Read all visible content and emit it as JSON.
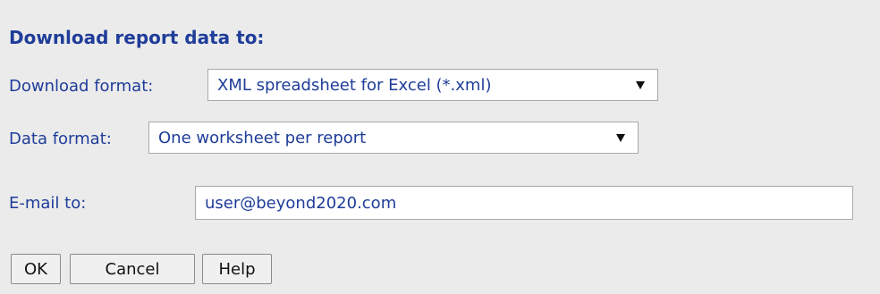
{
  "dialog": {
    "title": "Download report data to:"
  },
  "download_format": {
    "label": "Download format:",
    "selected": "XML spreadsheet for Excel (*.xml)"
  },
  "data_format": {
    "label": "Data format:",
    "selected": "One worksheet per report"
  },
  "email": {
    "label": "E-mail to:",
    "value": "user@beyond2020.com"
  },
  "buttons": {
    "ok": "OK",
    "cancel": "Cancel",
    "help": "Help"
  },
  "colors": {
    "label_text": "#1f3d99",
    "dialog_background": "#ebebeb"
  }
}
